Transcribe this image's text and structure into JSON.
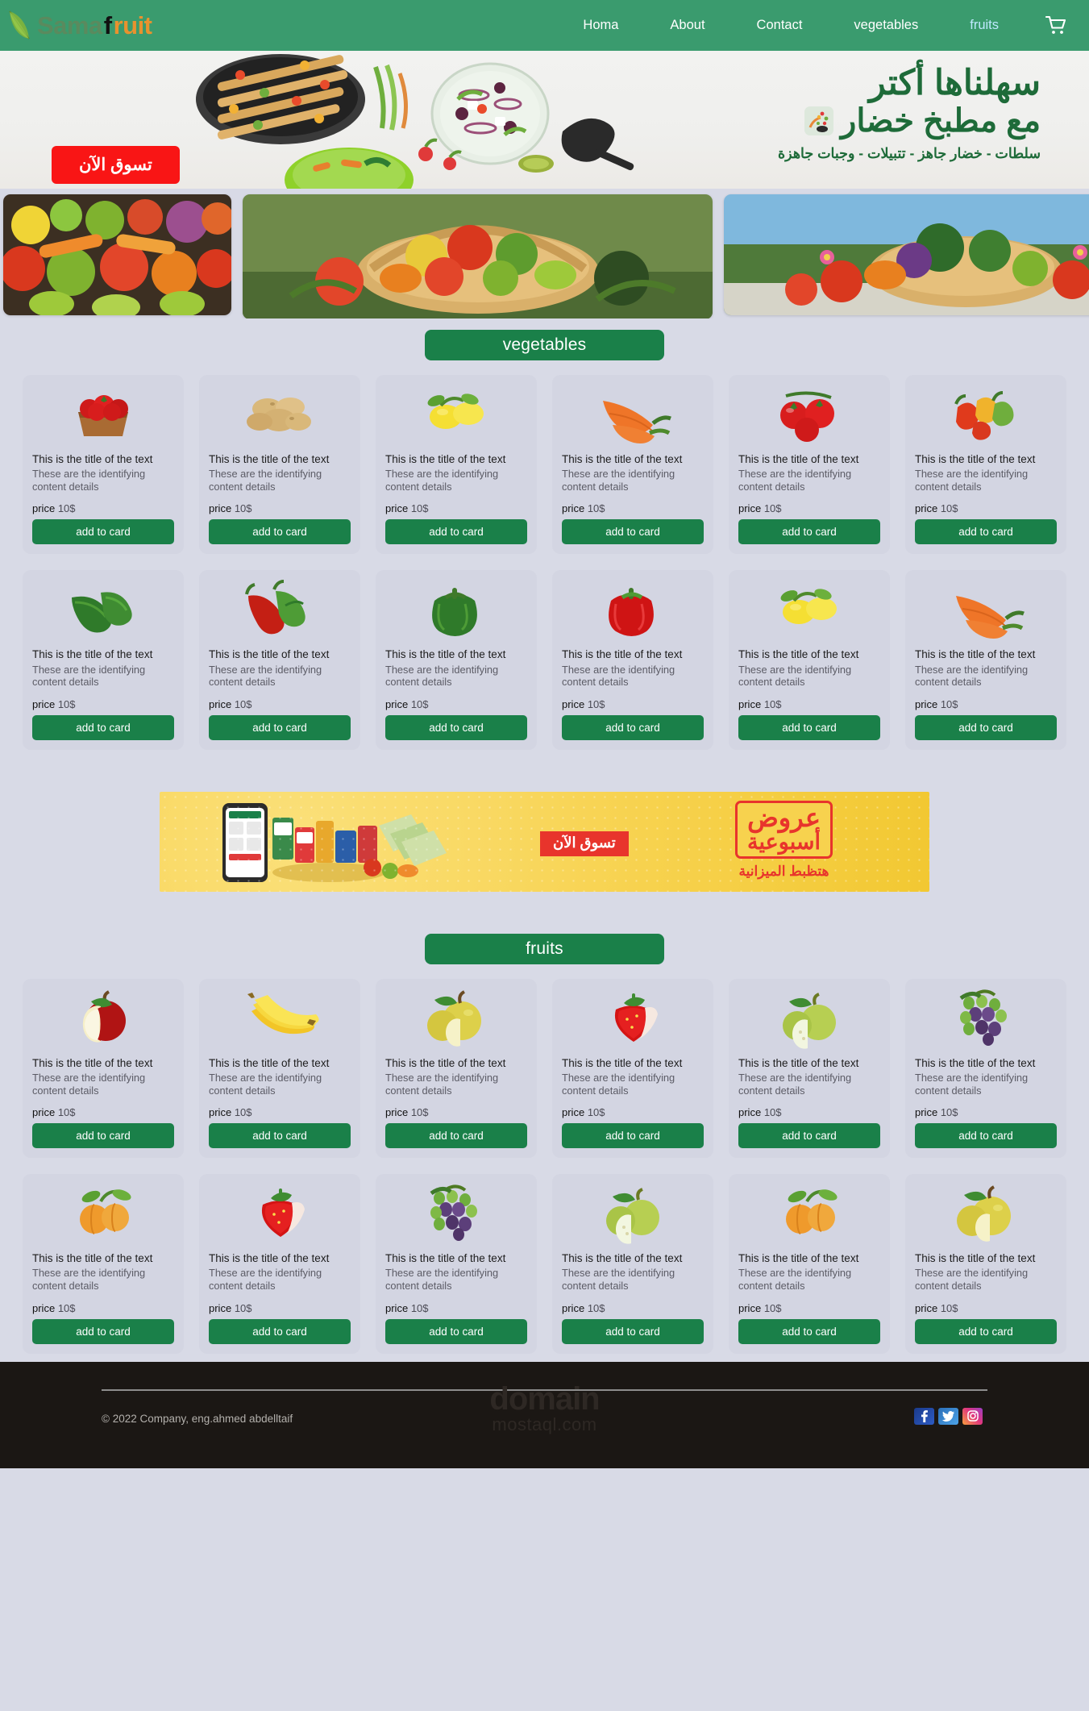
{
  "brand": {
    "part1": "Sama",
    "part2": "f",
    "part3": "ruit",
    "leaf_icon": "leaf-icon"
  },
  "nav": {
    "items": [
      {
        "label": "Homa",
        "accent": false
      },
      {
        "label": "About",
        "accent": false
      },
      {
        "label": "Contact",
        "accent": false
      },
      {
        "label": "vegetables",
        "accent": false
      },
      {
        "label": "fruits",
        "accent": true
      }
    ],
    "cart_icon": "shopping-cart-icon"
  },
  "hero": {
    "heading": "سهلناها أكتر",
    "subheading": "مع مطبخ خضار",
    "tagline": "سلطات - خضار جاهز - تتبيلات - وجبات جاهزة",
    "shop_now": "تسوق الآن"
  },
  "carousel": {
    "slides": [
      {
        "name": "mixed-vegetables-slide"
      },
      {
        "name": "vegetable-basket-slide"
      },
      {
        "name": "garden-basket-slide"
      }
    ]
  },
  "sections": [
    {
      "id": "vegetables",
      "title": "vegetables",
      "products": [
        {
          "image": "tomato-basket",
          "title": "This is the title of the text",
          "desc": "These are the identifying content details",
          "price_label": "price",
          "price_value": "10$",
          "button": "add to card"
        },
        {
          "image": "potatoes",
          "title": "This is the title of the text",
          "desc": "These are the identifying content details",
          "price_label": "price",
          "price_value": "10$",
          "button": "add to card"
        },
        {
          "image": "lemons",
          "title": "This is the title of the text",
          "desc": "These are the identifying content details",
          "price_label": "price",
          "price_value": "10$",
          "button": "add to card"
        },
        {
          "image": "carrots",
          "title": "This is the title of the text",
          "desc": "These are the identifying content details",
          "price_label": "price",
          "price_value": "10$",
          "button": "add to card"
        },
        {
          "image": "tomatoes-vine",
          "title": "This is the title of the text",
          "desc": "These are the identifying content details",
          "price_label": "price",
          "price_value": "10$",
          "button": "add to card"
        },
        {
          "image": "chili-peppers",
          "title": "This is the title of the text",
          "desc": "These are the identifying content details",
          "price_label": "price",
          "price_value": "10$",
          "button": "add to card"
        },
        {
          "image": "cucumbers",
          "title": "This is the title of the text",
          "desc": "These are the identifying content details",
          "price_label": "price",
          "price_value": "10$",
          "button": "add to card"
        },
        {
          "image": "green-chili",
          "title": "This is the title of the text",
          "desc": "These are the identifying content details",
          "price_label": "price",
          "price_value": "10$",
          "button": "add to card"
        },
        {
          "image": "green-bell-pepper",
          "title": "This is the title of the text",
          "desc": "These are the identifying content details",
          "price_label": "price",
          "price_value": "10$",
          "button": "add to card"
        },
        {
          "image": "red-bell-pepper",
          "title": "This is the title of the text",
          "desc": "These are the identifying content details",
          "price_label": "price",
          "price_value": "10$",
          "button": "add to card"
        },
        {
          "image": "lemons",
          "title": "This is the title of the text",
          "desc": "These are the identifying content details",
          "price_label": "price",
          "price_value": "10$",
          "button": "add to card"
        },
        {
          "image": "carrots",
          "title": "This is the title of the text",
          "desc": "These are the identifying content details",
          "price_label": "price",
          "price_value": "10$",
          "button": "add to card"
        }
      ]
    },
    {
      "id": "fruits",
      "title": "fruits",
      "products": [
        {
          "image": "red-apple",
          "title": "This is the title of the text",
          "desc": "These are the identifying content details",
          "price_label": "price",
          "price_value": "10$",
          "button": "add to card"
        },
        {
          "image": "bananas",
          "title": "This is the title of the text",
          "desc": "These are the identifying content details",
          "price_label": "price",
          "price_value": "10$",
          "button": "add to card"
        },
        {
          "image": "yellow-apple",
          "title": "This is the title of the text",
          "desc": "These are the identifying content details",
          "price_label": "price",
          "price_value": "10$",
          "button": "add to card"
        },
        {
          "image": "strawberry",
          "title": "This is the title of the text",
          "desc": "These are the identifying content details",
          "price_label": "price",
          "price_value": "10$",
          "button": "add to card"
        },
        {
          "image": "green-guava",
          "title": "This is the title of the text",
          "desc": "These are the identifying content details",
          "price_label": "price",
          "price_value": "10$",
          "button": "add to card"
        },
        {
          "image": "grapes",
          "title": "This is the title of the text",
          "desc": "These are the identifying content details",
          "price_label": "price",
          "price_value": "10$",
          "button": "add to card"
        },
        {
          "image": "apricots",
          "title": "This is the title of the text",
          "desc": "These are the identifying content details",
          "price_label": "price",
          "price_value": "10$",
          "button": "add to card"
        },
        {
          "image": "strawberry",
          "title": "This is the title of the text",
          "desc": "These are the identifying content details",
          "price_label": "price",
          "price_value": "10$",
          "button": "add to card"
        },
        {
          "image": "grapes",
          "title": "This is the title of the text",
          "desc": "These are the identifying content details",
          "price_label": "price",
          "price_value": "10$",
          "button": "add to card"
        },
        {
          "image": "green-guava",
          "title": "This is the title of the text",
          "desc": "These are the identifying content details",
          "price_label": "price",
          "price_value": "10$",
          "button": "add to card"
        },
        {
          "image": "apricots",
          "title": "This is the title of the text",
          "desc": "These are the identifying content details",
          "price_label": "price",
          "price_value": "10$",
          "button": "add to card"
        },
        {
          "image": "yellow-apple",
          "title": "This is the title of the text",
          "desc": "These are the identifying content details",
          "price_label": "price",
          "price_value": "10$",
          "button": "add to card"
        }
      ]
    }
  ],
  "promo": {
    "shop_now": "تسوق الآن",
    "line1": "عروض",
    "line2": "أسبوعية",
    "line3": "هتظبط الميزانية"
  },
  "footer": {
    "copyright": "© 2022 Company, eng.ahmed abdelltaif",
    "watermark_1": "domain",
    "watermark_2": "mostaql.com",
    "social": [
      {
        "name": "facebook-icon",
        "glyph": "f"
      },
      {
        "name": "twitter-icon",
        "glyph": "🐦"
      },
      {
        "name": "instagram-icon",
        "glyph": "◎"
      }
    ]
  },
  "colors": {
    "nav_green": "#3a9b6e",
    "accent_green": "#1a8049",
    "hero_green": "#1e6b39",
    "red": "#f91515",
    "promo_yellow": "#f7d24e",
    "page_bg": "#d8dae6"
  }
}
